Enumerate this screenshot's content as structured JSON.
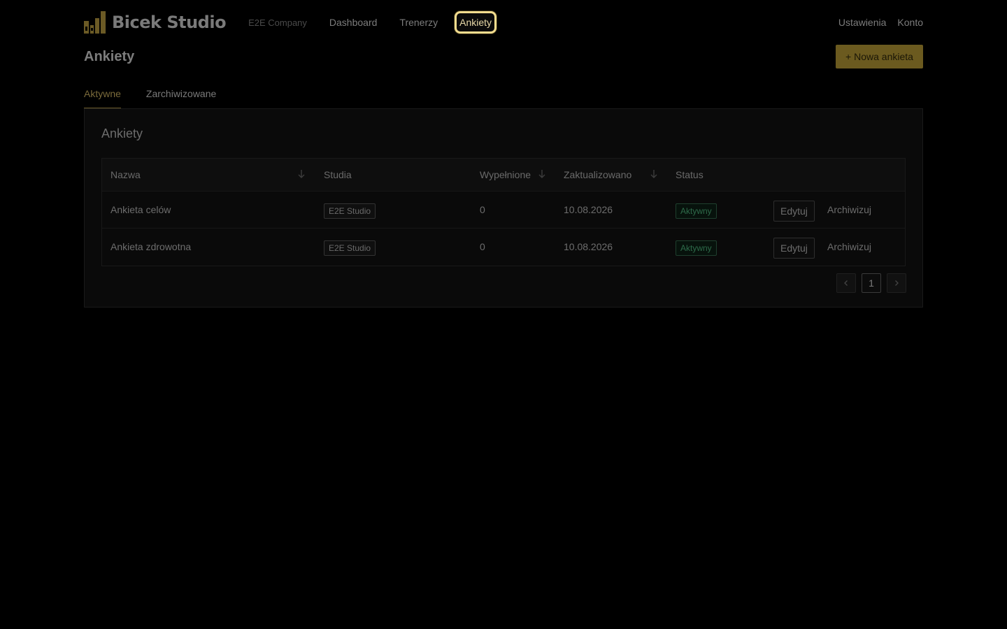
{
  "nav": {
    "brand": "Bicek Studio",
    "company": "E2E Company",
    "links": [
      "Dashboard",
      "Trenerzy",
      "Ankiety"
    ],
    "right": [
      "Ustawienia",
      "Konto"
    ],
    "accent": "#f2dc8e"
  },
  "page": {
    "title": "Ankiety",
    "new_button": "+ Nowa ankieta"
  },
  "tabs": [
    "Aktywne",
    "Zarchiwizowane"
  ],
  "card": {
    "title": "Ankiety"
  },
  "table": {
    "headers": [
      "Nazwa",
      "Studia",
      "Wypełnione",
      "Zaktualizowano",
      "Status"
    ],
    "rows": [
      {
        "name": "Ankieta celów",
        "studio": "E2E Studio",
        "filled": "0",
        "updated": "10.08.2026",
        "status": "Aktywny",
        "edit": "Edytuj",
        "archive": "Archiwizuj"
      },
      {
        "name": "Ankieta zdrowotna",
        "studio": "E2E Studio",
        "filled": "0",
        "updated": "10.08.2026",
        "status": "Aktywny",
        "edit": "Edytuj",
        "archive": "Archiwizuj"
      }
    ]
  },
  "pagination": {
    "current_page": "1"
  }
}
